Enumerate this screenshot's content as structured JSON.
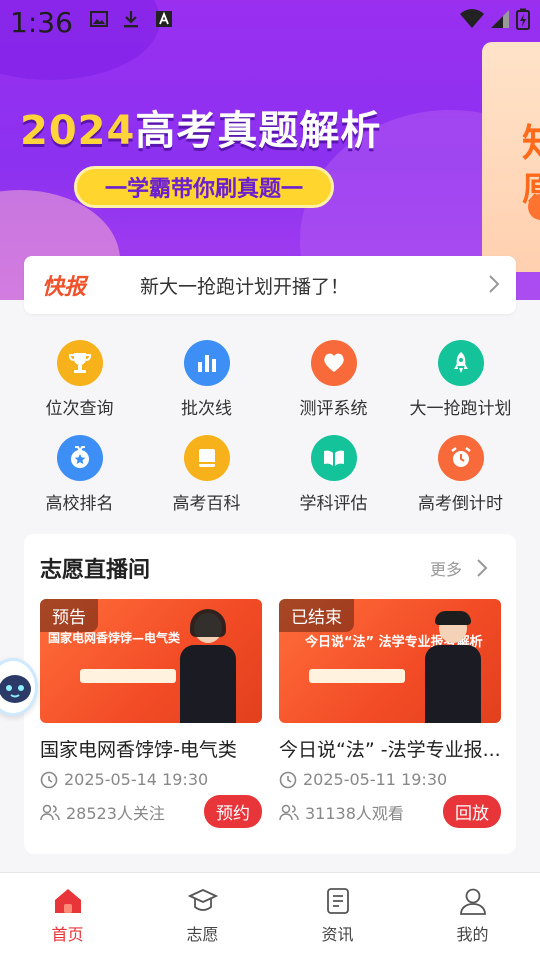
{
  "status_bar": {
    "time": "1:36"
  },
  "banner": {
    "year": "2024",
    "title": "高考真题解析",
    "subtitle": "一学霸带你刷真题一",
    "side_text": "知 原"
  },
  "news": {
    "badge": "快报",
    "text": "新大一抢跑计划开播了！"
  },
  "grid": {
    "items": [
      {
        "label": "位次查询",
        "icon": "trophy-icon",
        "color": "#f7b21b"
      },
      {
        "label": "批次线",
        "icon": "bar-chart-icon",
        "color": "#3e8ff5"
      },
      {
        "label": "测评系统",
        "icon": "heart-icon",
        "color": "#f86a3a"
      },
      {
        "label": "大一抢跑计划",
        "icon": "rocket-icon",
        "color": "#14c39a"
      },
      {
        "label": "高校排名",
        "icon": "medal-icon",
        "color": "#3e8ff5"
      },
      {
        "label": "高考百科",
        "icon": "book-icon",
        "color": "#f7b21b"
      },
      {
        "label": "学科评估",
        "icon": "open-book-icon",
        "color": "#14c39a"
      },
      {
        "label": "高考倒计时",
        "icon": "alarm-clock-icon",
        "color": "#f86a3a"
      }
    ]
  },
  "live": {
    "heading": "志愿直播间",
    "more": "更多",
    "items": [
      {
        "tag": "预告",
        "thumb_title": "国家电网香饽饽—电气类",
        "title": "国家电网香饽饽-电气类",
        "datetime": "2025-05-14 19:30",
        "count": "28523人关注",
        "action": "预约"
      },
      {
        "tag": "已结束",
        "thumb_title": "今日说“法” 法学专业报考解析",
        "title": "今日说“法” -法学专业报...",
        "datetime": "2025-05-11 19:30",
        "count": "31138人观看",
        "action": "回放"
      }
    ]
  },
  "tabbar": {
    "tabs": [
      {
        "label": "首页",
        "icon": "home-icon",
        "active": true
      },
      {
        "label": "志愿",
        "icon": "graduation-cap-icon",
        "active": false
      },
      {
        "label": "资讯",
        "icon": "news-icon",
        "active": false
      },
      {
        "label": "我的",
        "icon": "user-icon",
        "active": false
      }
    ]
  },
  "colors": {
    "accent": "#e8353a",
    "banner": "#9a2ff0",
    "news_badge": "#f0522b"
  }
}
